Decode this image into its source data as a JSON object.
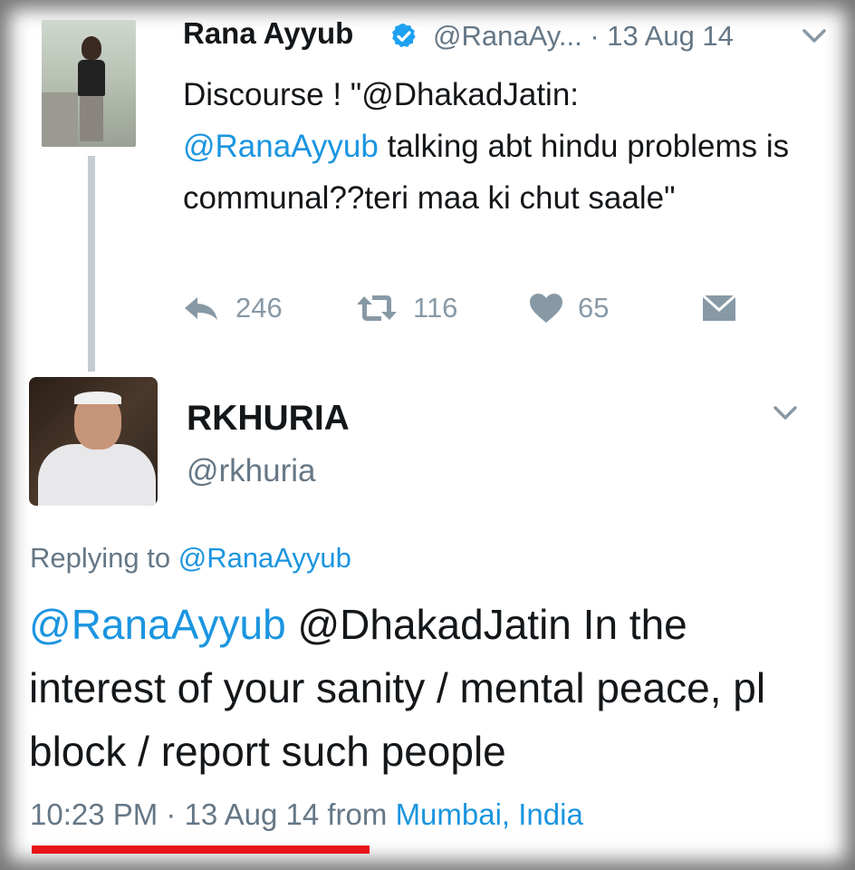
{
  "parent_tweet": {
    "author_name": "Rana Ayyub",
    "author_handle_date": "@RanaAy... · 13 Aug 14",
    "text_prefix": "Discourse ! \"@DhakadJatin:",
    "mention": "@RanaAyyub",
    "text_suffix": " talking abt hindu problems is communal??teri maa ki chut saale\"",
    "reply_count": "246",
    "retweet_count": "116",
    "like_count": "65",
    "verified": true
  },
  "reply_tweet": {
    "author_name": "RKHURIA",
    "author_handle": "@rkhuria",
    "replying_label": "Replying to ",
    "replying_to": "@RanaAyyub",
    "mention": "@RanaAyyub",
    "text": " @DhakadJatin In the interest of your sanity / mental peace, pl block / report such people",
    "time": "10:23 PM · 13 Aug 14 from ",
    "location": "Mumbai, India"
  },
  "colors": {
    "link": "#1b95e0",
    "secondary_text": "#657786",
    "underline": "#e8141a",
    "verified": "#1da1f2"
  },
  "icons": [
    "reply-icon",
    "retweet-icon",
    "like-icon",
    "direct-message-icon",
    "chevron-down-icon",
    "verified-badge-icon"
  ]
}
